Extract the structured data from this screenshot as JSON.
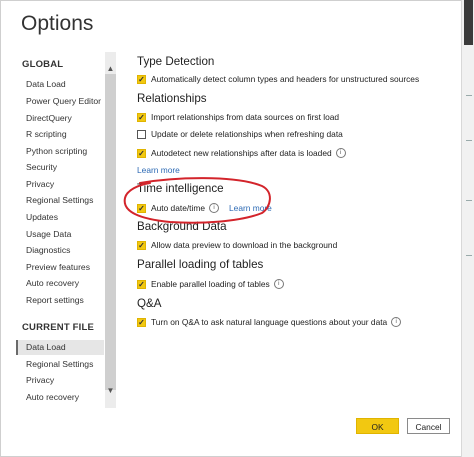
{
  "window": {
    "title": "Options"
  },
  "nav": {
    "global_header": "GLOBAL",
    "global_items": [
      {
        "label": "Data Load"
      },
      {
        "label": "Power Query Editor"
      },
      {
        "label": "DirectQuery"
      },
      {
        "label": "R scripting"
      },
      {
        "label": "Python scripting"
      },
      {
        "label": "Security"
      },
      {
        "label": "Privacy"
      },
      {
        "label": "Regional Settings"
      },
      {
        "label": "Updates"
      },
      {
        "label": "Usage Data"
      },
      {
        "label": "Diagnostics"
      },
      {
        "label": "Preview features"
      },
      {
        "label": "Auto recovery"
      },
      {
        "label": "Report settings"
      }
    ],
    "current_file_header": "CURRENT FILE",
    "current_file_items": [
      {
        "label": "Data Load",
        "selected": true
      },
      {
        "label": "Regional Settings"
      },
      {
        "label": "Privacy"
      },
      {
        "label": "Auto recovery"
      }
    ],
    "scroll_up": "▲",
    "scroll_down": "▼"
  },
  "sections": {
    "type_detection": {
      "title": "Type Detection",
      "auto_detect": {
        "label": "Automatically detect column types and headers for unstructured sources",
        "checked": true
      }
    },
    "relationships": {
      "title": "Relationships",
      "import_rel": {
        "label": "Import relationships from data sources on first load",
        "checked": true
      },
      "update_delete": {
        "label": "Update or delete relationships when refreshing data",
        "checked": false
      },
      "autodetect": {
        "label": "Autodetect new relationships after data is loaded",
        "checked": true
      },
      "learn_more": "Learn more"
    },
    "time_intelligence": {
      "title": "Time intelligence",
      "auto_datetime": {
        "label": "Auto date/time",
        "checked": true
      },
      "learn_more": "Learn more"
    },
    "background_data": {
      "title": "Background Data",
      "allow_preview": {
        "label": "Allow data preview to download in the background",
        "checked": true
      }
    },
    "parallel": {
      "title": "Parallel loading of tables",
      "enable_parallel": {
        "label": "Enable parallel loading of tables",
        "checked": true
      }
    },
    "qa": {
      "title": "Q&A",
      "turn_on": {
        "label": "Turn on Q&A to ask natural language questions about your data",
        "checked": true
      }
    }
  },
  "icons": {
    "check": "✓",
    "info": "i"
  },
  "colors": {
    "accent_yellow": "#f2c811",
    "link_blue": "#2d6ab4",
    "annotation_red": "#d3242b"
  },
  "buttons": {
    "ok": "OK",
    "cancel": "Cancel"
  }
}
